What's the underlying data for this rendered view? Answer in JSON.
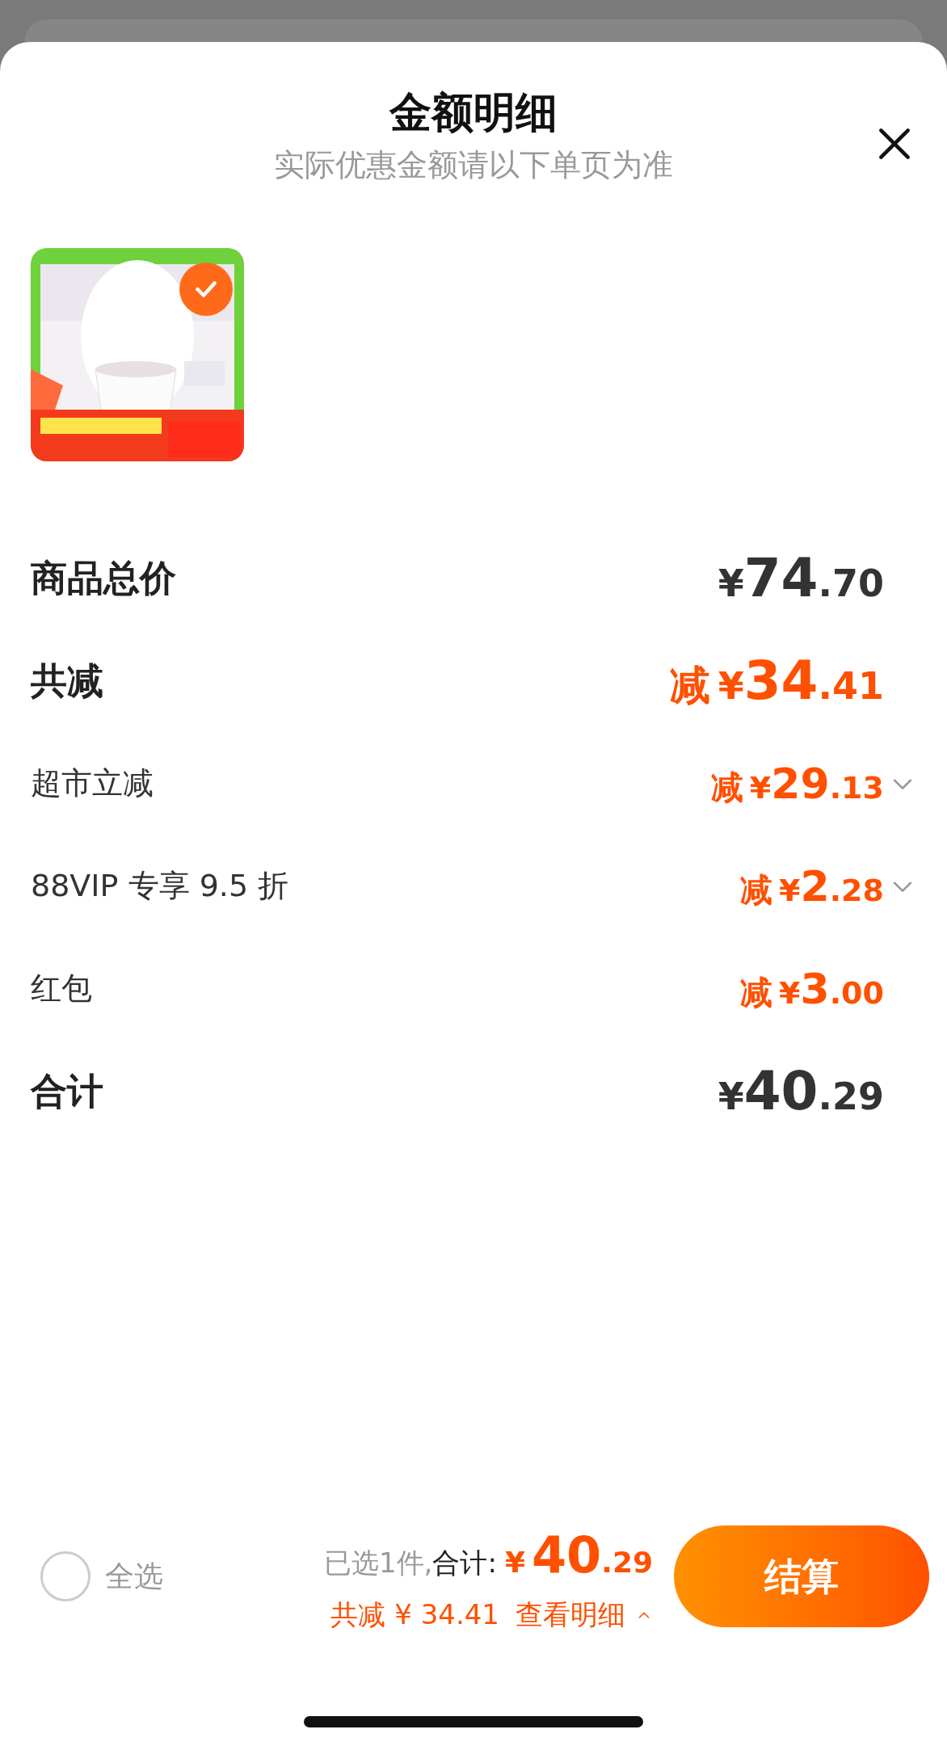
{
  "sheet": {
    "title": "金额明细",
    "subtitle": "实际优惠金额请以下单页为准"
  },
  "product": {
    "kind": "picture",
    "checked": true
  },
  "rows": [
    {
      "label": "商品总价",
      "kind": "main",
      "currency": "¥",
      "integer": "74",
      "decimal": ".70",
      "expandable": false
    },
    {
      "label": "共减",
      "kind": "main-discount",
      "prefix": "减",
      "currency": "¥",
      "integer": "34",
      "decimal": ".41",
      "expandable": false
    },
    {
      "label": "超市立减",
      "kind": "sub-discount",
      "prefix": "减",
      "currency": "¥",
      "integer": "29",
      "decimal": ".13",
      "expandable": true
    },
    {
      "label": "88VIP 专享 9.5 折",
      "kind": "sub-discount",
      "prefix": "减",
      "currency": "¥",
      "integer": "2",
      "decimal": ".28",
      "expandable": true
    },
    {
      "label": "红包",
      "kind": "sub-discount",
      "prefix": "减",
      "currency": "¥",
      "integer": "3",
      "decimal": ".00",
      "expandable": false
    },
    {
      "label": "合计",
      "kind": "main",
      "currency": "¥",
      "integer": "40",
      "decimal": ".29",
      "expandable": false
    }
  ],
  "footer": {
    "select_all": {
      "label": "全选",
      "checked": false
    },
    "selected_count": "已选1件,",
    "total_label": "合计:",
    "currency": "¥",
    "integer": "40",
    "decimal": ".29",
    "discount_text": "共减 ¥ 34.41",
    "details_link": "查看明细",
    "details_expanded": true,
    "checkout_button": "结算"
  }
}
